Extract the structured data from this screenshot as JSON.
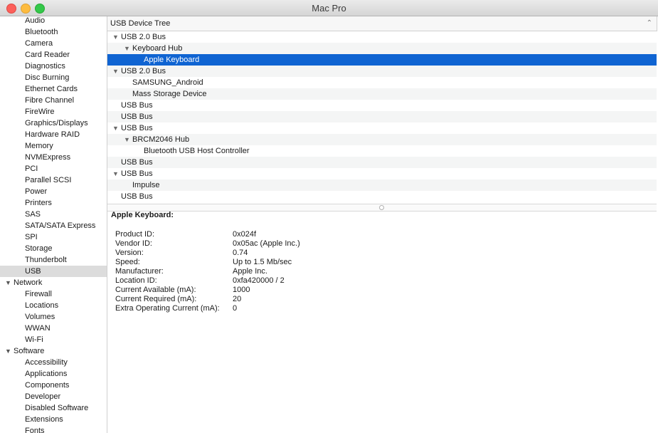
{
  "window": {
    "title": "Mac Pro"
  },
  "sidebar": {
    "hardware_items": [
      "Audio",
      "Bluetooth",
      "Camera",
      "Card Reader",
      "Diagnostics",
      "Disc Burning",
      "Ethernet Cards",
      "Fibre Channel",
      "FireWire",
      "Graphics/Displays",
      "Hardware RAID",
      "Memory",
      "NVMExpress",
      "PCI",
      "Parallel SCSI",
      "Power",
      "Printers",
      "SAS",
      "SATA/SATA Express",
      "SPI",
      "Storage",
      "Thunderbolt",
      "USB"
    ],
    "network_label": "Network",
    "network_items": [
      "Firewall",
      "Locations",
      "Volumes",
      "WWAN",
      "Wi-Fi"
    ],
    "software_label": "Software",
    "software_items": [
      "Accessibility",
      "Applications",
      "Components",
      "Developer",
      "Disabled Software",
      "Extensions",
      "Fonts"
    ],
    "selected": "USB"
  },
  "tree": {
    "header": "USB Device Tree",
    "rows": [
      {
        "label": "USB 2.0 Bus",
        "level": 0,
        "expandable": true
      },
      {
        "label": "Keyboard Hub",
        "level": 1,
        "expandable": true
      },
      {
        "label": "Apple Keyboard",
        "level": 2,
        "expandable": false,
        "selected": true
      },
      {
        "label": "USB 2.0 Bus",
        "level": 0,
        "expandable": true
      },
      {
        "label": "SAMSUNG_Android",
        "level": 1,
        "expandable": false
      },
      {
        "label": "Mass Storage Device",
        "level": 1,
        "expandable": false
      },
      {
        "label": "USB Bus",
        "level": 0,
        "expandable": false
      },
      {
        "label": "USB Bus",
        "level": 0,
        "expandable": false
      },
      {
        "label": "USB Bus",
        "level": 0,
        "expandable": true
      },
      {
        "label": "BRCM2046 Hub",
        "level": 1,
        "expandable": true
      },
      {
        "label": "Bluetooth USB Host Controller",
        "level": 2,
        "expandable": false
      },
      {
        "label": "USB Bus",
        "level": 0,
        "expandable": false
      },
      {
        "label": "USB Bus",
        "level": 0,
        "expandable": true
      },
      {
        "label": "Impulse",
        "level": 1,
        "expandable": false
      },
      {
        "label": "USB Bus",
        "level": 0,
        "expandable": false
      }
    ]
  },
  "details": {
    "heading": "Apple Keyboard:",
    "fields": [
      {
        "key": "Product ID:",
        "value": "0x024f"
      },
      {
        "key": "Vendor ID:",
        "value": "0x05ac  (Apple Inc.)"
      },
      {
        "key": "Version:",
        "value": "0.74"
      },
      {
        "key": "Speed:",
        "value": "Up to 1.5 Mb/sec"
      },
      {
        "key": "Manufacturer:",
        "value": "Apple Inc."
      },
      {
        "key": "Location ID:",
        "value": "0xfa420000 / 2"
      },
      {
        "key": "Current Available (mA):",
        "value": "1000"
      },
      {
        "key": "Current Required (mA):",
        "value": "20"
      },
      {
        "key": "Extra Operating Current (mA):",
        "value": "0"
      }
    ]
  }
}
